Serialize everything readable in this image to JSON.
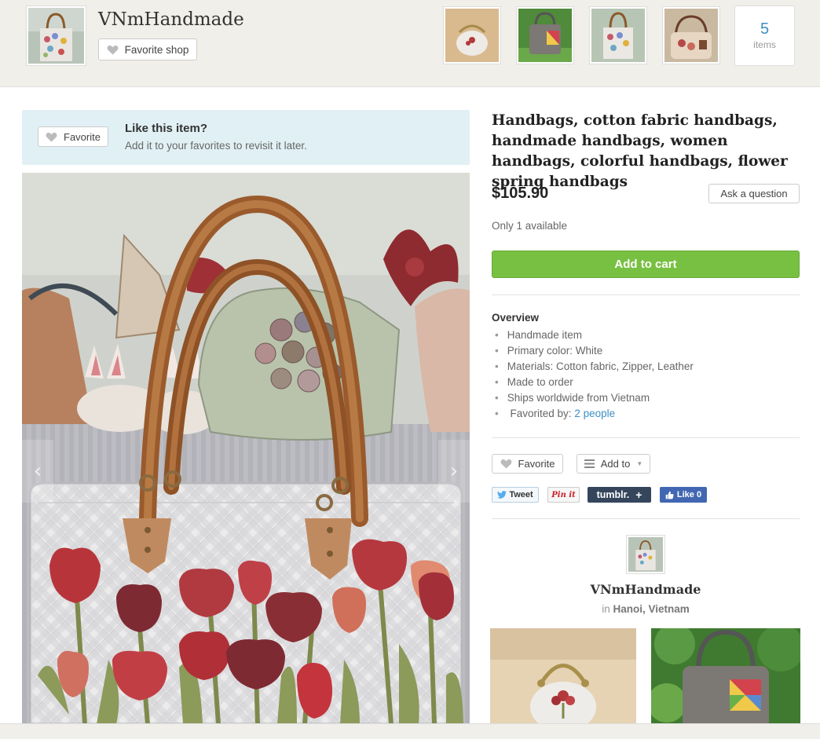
{
  "header": {
    "shop_name": "VNmHandmade",
    "favorite_shop_label": "Favorite shop",
    "thumbnails": [
      "coin-purse-thumbnail",
      "patchwork-bag-thumbnail",
      "tote-bag-thumbnail",
      "flower-bag-thumbnail"
    ],
    "items_count": "5",
    "items_label": "items"
  },
  "like_box": {
    "favorite_label": "Favorite",
    "title": "Like this item?",
    "subtitle": "Add it to your favorites to revisit it later."
  },
  "photo": {
    "prev_icon": "‹",
    "next_icon": "›"
  },
  "listing": {
    "title": "Handbags, cotton fabric handbags, handmade handbags, women handbags, colorful handbags, flower spring handbags",
    "price": "$105.90",
    "ask_label": "Ask a question",
    "availability": "Only 1 available",
    "add_to_cart_label": "Add to cart"
  },
  "overview": {
    "title": "Overview",
    "items": [
      "Handmade item",
      "Primary color: White",
      "Materials: Cotton fabric, Zipper, Leather",
      "Made to order",
      "Ships worldwide from Vietnam"
    ],
    "favorited_prefix": "Favorited by:",
    "favorited_link": "2 people"
  },
  "actions": {
    "favorite_label": "Favorite",
    "add_to_label": "Add to",
    "tweet_label": "Tweet",
    "pin_label": "Pin it",
    "tumblr_label": "tumblr.",
    "like_label": "Like 0"
  },
  "shop_card": {
    "name": "VNmHandmade",
    "location_prefix": "in",
    "location": "Hanoi, Vietnam"
  },
  "colors": {
    "accent_blue": "#3d8ec5",
    "cart_green": "#78c042",
    "like_box_bg": "#e1f0f4",
    "page_bg": "#f0efe9"
  }
}
